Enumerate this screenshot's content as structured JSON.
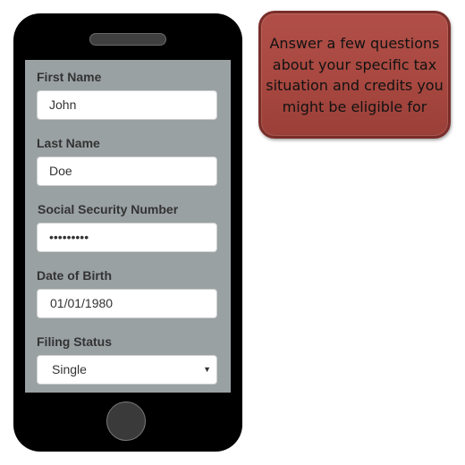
{
  "form": {
    "first_name": {
      "label": "First Name",
      "value": "John"
    },
    "last_name": {
      "label": "Last Name",
      "value": "Doe"
    },
    "ssn": {
      "label": "Social Security Number",
      "value": "•••••••••"
    },
    "dob": {
      "label": "Date of Birth",
      "value": "01/01/1980"
    },
    "filing_status": {
      "label": "Filing Status",
      "value": "Single",
      "caret": "▼"
    }
  },
  "callout": {
    "text": "Answer a few questions about your specific tax situation and credits you might be eligible for"
  },
  "colors": {
    "phone": "#000000",
    "screen": "#9aa1a3",
    "callout": "#a84840"
  }
}
